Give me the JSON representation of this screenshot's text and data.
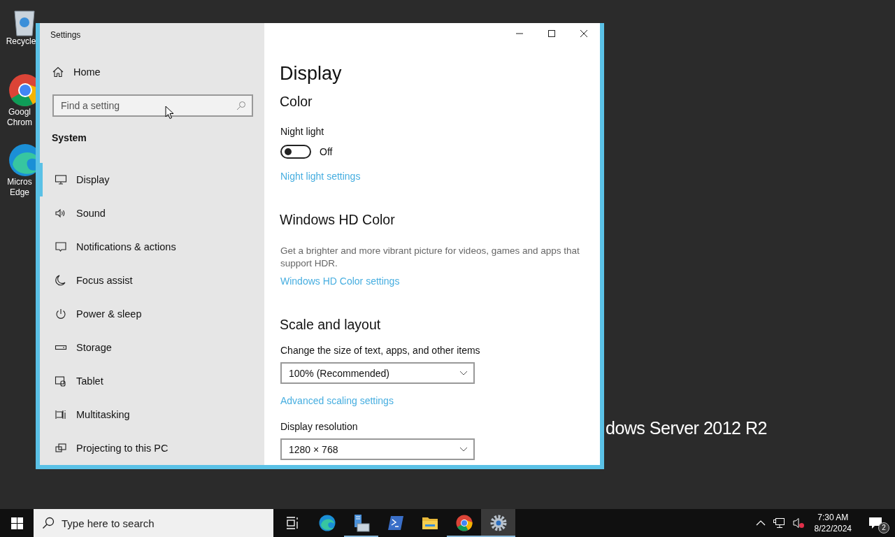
{
  "desktop": {
    "icons": [
      {
        "lines": [
          "Recycle"
        ]
      },
      {
        "lines": [
          "Googl",
          "Chrom"
        ]
      },
      {
        "lines": [
          "Micros",
          "Edge"
        ]
      }
    ],
    "background_text": "dows Server 2012 R2"
  },
  "window": {
    "title": "Settings"
  },
  "sidebar": {
    "home": "Home",
    "search": {
      "placeholder": "Find a setting"
    },
    "section": "System",
    "items": [
      {
        "label": "Display",
        "selected": true
      },
      {
        "label": "Sound",
        "selected": false
      },
      {
        "label": "Notifications & actions",
        "selected": false
      },
      {
        "label": "Focus assist",
        "selected": false
      },
      {
        "label": "Power & sleep",
        "selected": false
      },
      {
        "label": "Storage",
        "selected": false
      },
      {
        "label": "Tablet",
        "selected": false
      },
      {
        "label": "Multitasking",
        "selected": false
      },
      {
        "label": "Projecting to this PC",
        "selected": false
      }
    ]
  },
  "page": {
    "title": "Display",
    "color": {
      "heading": "Color",
      "night_light": {
        "label": "Night light",
        "on": false,
        "state_text": "Off"
      },
      "link": "Night light settings"
    },
    "hd_color": {
      "heading": "Windows HD Color",
      "description": "Get a brighter and more vibrant picture for videos, games and apps that support HDR.",
      "link": "Windows HD Color settings"
    },
    "scale": {
      "heading": "Scale and layout",
      "size_label": "Change the size of text, apps, and other items",
      "size_value": "100% (Recommended)",
      "link": "Advanced scaling settings",
      "resolution_label": "Display resolution",
      "resolution_value": "1280 × 768"
    }
  },
  "taskbar": {
    "search": {
      "placeholder": "Type here to search"
    },
    "apps": [
      {
        "selected": false,
        "running": false
      },
      {
        "selected": false,
        "running": false
      },
      {
        "selected": false,
        "running": true
      },
      {
        "selected": false,
        "running": false
      },
      {
        "selected": false,
        "running": false
      },
      {
        "selected": false,
        "running": true
      },
      {
        "selected": true,
        "running": true
      }
    ],
    "time": "7:30 AM",
    "date": "8/22/2024",
    "notification_count": "2"
  }
}
